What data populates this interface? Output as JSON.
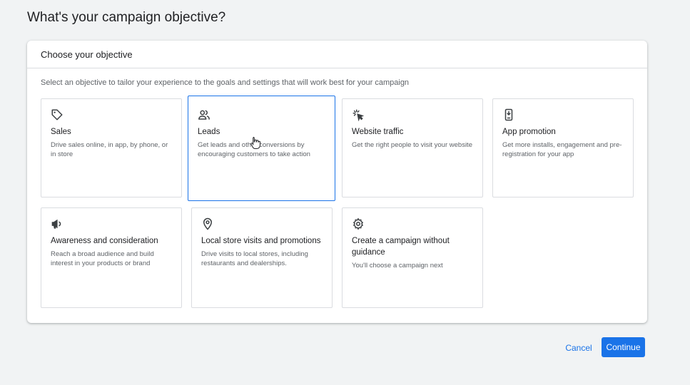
{
  "page": {
    "title": "What's your campaign objective?"
  },
  "panel": {
    "header": "Choose your objective",
    "description": "Select an objective to tailor your experience to the goals and settings that will work best for your campaign"
  },
  "objectives": [
    {
      "icon": "tag-icon",
      "title": "Sales",
      "description": "Drive sales online, in app, by phone, or in store"
    },
    {
      "icon": "people-icon",
      "title": "Leads",
      "description": "Get leads and other conversions by encouraging customers to take action",
      "selected": true
    },
    {
      "icon": "cursor-click-icon",
      "title": "Website traffic",
      "description": "Get the right people to visit your website"
    },
    {
      "icon": "phone-download-icon",
      "title": "App promotion",
      "description": "Get more installs, engagement and pre-registration for your app"
    },
    {
      "icon": "megaphone-icon",
      "title": "Awareness and consideration",
      "description": "Reach a broad audience and build interest in your products or brand"
    },
    {
      "icon": "location-pin-icon",
      "title": "Local store visits and promotions",
      "description": "Drive visits to local stores, including restaurants and dealerships."
    },
    {
      "icon": "gear-icon",
      "title": "Create a campaign without guidance",
      "description": "You'll choose a campaign next"
    }
  ],
  "actions": {
    "cancel": "Cancel",
    "continue": "Continue"
  },
  "colors": {
    "accent": "#1a73e8",
    "background": "#f1f3f4",
    "border": "#dadce0"
  }
}
